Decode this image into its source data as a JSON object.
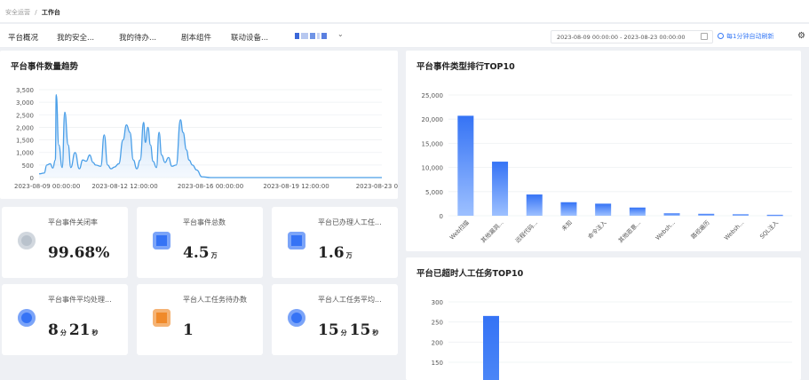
{
  "breadcrumb": {
    "parent": "安全运营",
    "sep": "/",
    "current": "工作台"
  },
  "tabs": [
    "平台概况",
    "我的安全...",
    "我的待办...",
    "剧本组件",
    "联动设备..."
  ],
  "toolbar": {
    "date_range": "2023-08-09 00:00:00  -  2023-08-23 00:00:00",
    "auto_refresh": "每1分钟自动刷新"
  },
  "colors": {
    "accent": "#3a7bf6",
    "bar": "#3573f5",
    "bar_light": "#9dc0ff",
    "line": "#4a9fe8"
  },
  "trend": {
    "title": "平台事件数量趋势",
    "chart_data": {
      "type": "area",
      "ylim": [
        0,
        3500
      ],
      "yticks": [
        "3,500",
        "3,000",
        "2,500",
        "2,000",
        "1,500",
        "1,000",
        "500",
        "0"
      ],
      "xticks": [
        "2023-08-09 00:00:00",
        "2023-08-12 12:00:00",
        "2023-08-16 00:00:00",
        "2023-08-19 12:00:00",
        "2023-08-23 00:0"
      ],
      "points": [
        [
          0,
          150
        ],
        [
          0.06,
          180
        ],
        [
          0.09,
          500
        ],
        [
          0.13,
          550
        ],
        [
          0.16,
          380
        ],
        [
          0.19,
          700
        ],
        [
          0.2,
          3300
        ],
        [
          0.23,
          1300
        ],
        [
          0.27,
          400
        ],
        [
          0.3,
          2600
        ],
        [
          0.34,
          1300
        ],
        [
          0.37,
          400
        ],
        [
          0.42,
          1000
        ],
        [
          0.47,
          350
        ],
        [
          0.51,
          700
        ],
        [
          0.55,
          650
        ],
        [
          0.59,
          900
        ],
        [
          0.63,
          600
        ],
        [
          0.66,
          500
        ],
        [
          0.72,
          450
        ],
        [
          0.76,
          1700
        ],
        [
          0.8,
          500
        ],
        [
          0.84,
          350
        ],
        [
          0.88,
          420
        ],
        [
          0.93,
          550
        ],
        [
          0.98,
          1500
        ],
        [
          1.02,
          2100
        ],
        [
          1.06,
          1800
        ],
        [
          1.1,
          700
        ],
        [
          1.14,
          350
        ],
        [
          1.18,
          700
        ],
        [
          1.22,
          2200
        ],
        [
          1.24,
          1400
        ],
        [
          1.27,
          2000
        ],
        [
          1.3,
          1300
        ],
        [
          1.33,
          650
        ],
        [
          1.37,
          400
        ],
        [
          1.4,
          1800
        ],
        [
          1.43,
          900
        ],
        [
          1.47,
          600
        ],
        [
          1.51,
          800
        ],
        [
          1.55,
          450
        ],
        [
          1.6,
          500
        ],
        [
          1.65,
          2300
        ],
        [
          1.68,
          1800
        ],
        [
          1.72,
          1100
        ],
        [
          1.75,
          700
        ],
        [
          1.79,
          500
        ],
        [
          1.84,
          300
        ],
        [
          1.9,
          30
        ],
        [
          2.0,
          0
        ],
        [
          3.0,
          0
        ],
        [
          4.0,
          0
        ]
      ]
    }
  },
  "cards": [
    {
      "label": "平台事件关闭率",
      "value": "99.68%",
      "units": [],
      "icon": "gauge-icon",
      "color": "#b9c2cc"
    },
    {
      "label": "平台事件总数",
      "value": "4.5",
      "units": [
        "万"
      ],
      "icon": "doc-arrow-icon",
      "color": "#3573f5"
    },
    {
      "label": "平台已办理人工任...",
      "value": "1.6",
      "units": [
        "万"
      ],
      "icon": "task-check-icon",
      "color": "#3573f5"
    },
    {
      "label": "平台事件平均处理...",
      "value": "8",
      "units": [
        "分",
        "21",
        "秒"
      ],
      "icon": "clock-icon",
      "color": "#3573f5"
    },
    {
      "label": "平台人工任务待办数",
      "value": "1",
      "units": [],
      "icon": "todo-icon",
      "color": "#f08a2a"
    },
    {
      "label": "平台人工任务平均...",
      "value": "15",
      "units": [
        "分",
        "15",
        "秒"
      ],
      "icon": "clock-icon",
      "color": "#3573f5"
    }
  ],
  "top10": {
    "title": "平台事件类型排行TOP10",
    "chart_data": {
      "type": "bar",
      "ylim": [
        0,
        25000
      ],
      "yticks": [
        "25,000",
        "20,000",
        "15,000",
        "10,000",
        "5,000",
        "0"
      ],
      "categories": [
        "Web扫描",
        "其他漏洞...",
        "远程代码...",
        "未知",
        "命令注入",
        "其他恶意...",
        "Websh...",
        "路径遍历",
        "Websh...",
        "SQL注入"
      ],
      "values": [
        20700,
        11200,
        4400,
        2800,
        2500,
        1700,
        500,
        400,
        300,
        200
      ]
    }
  },
  "overtime": {
    "title": "平台已超时人工任务TOP10",
    "chart_data": {
      "type": "bar",
      "ylim": [
        150,
        300
      ],
      "yticks": [
        "300",
        "250",
        "200",
        "150"
      ],
      "values": [
        265
      ]
    }
  }
}
